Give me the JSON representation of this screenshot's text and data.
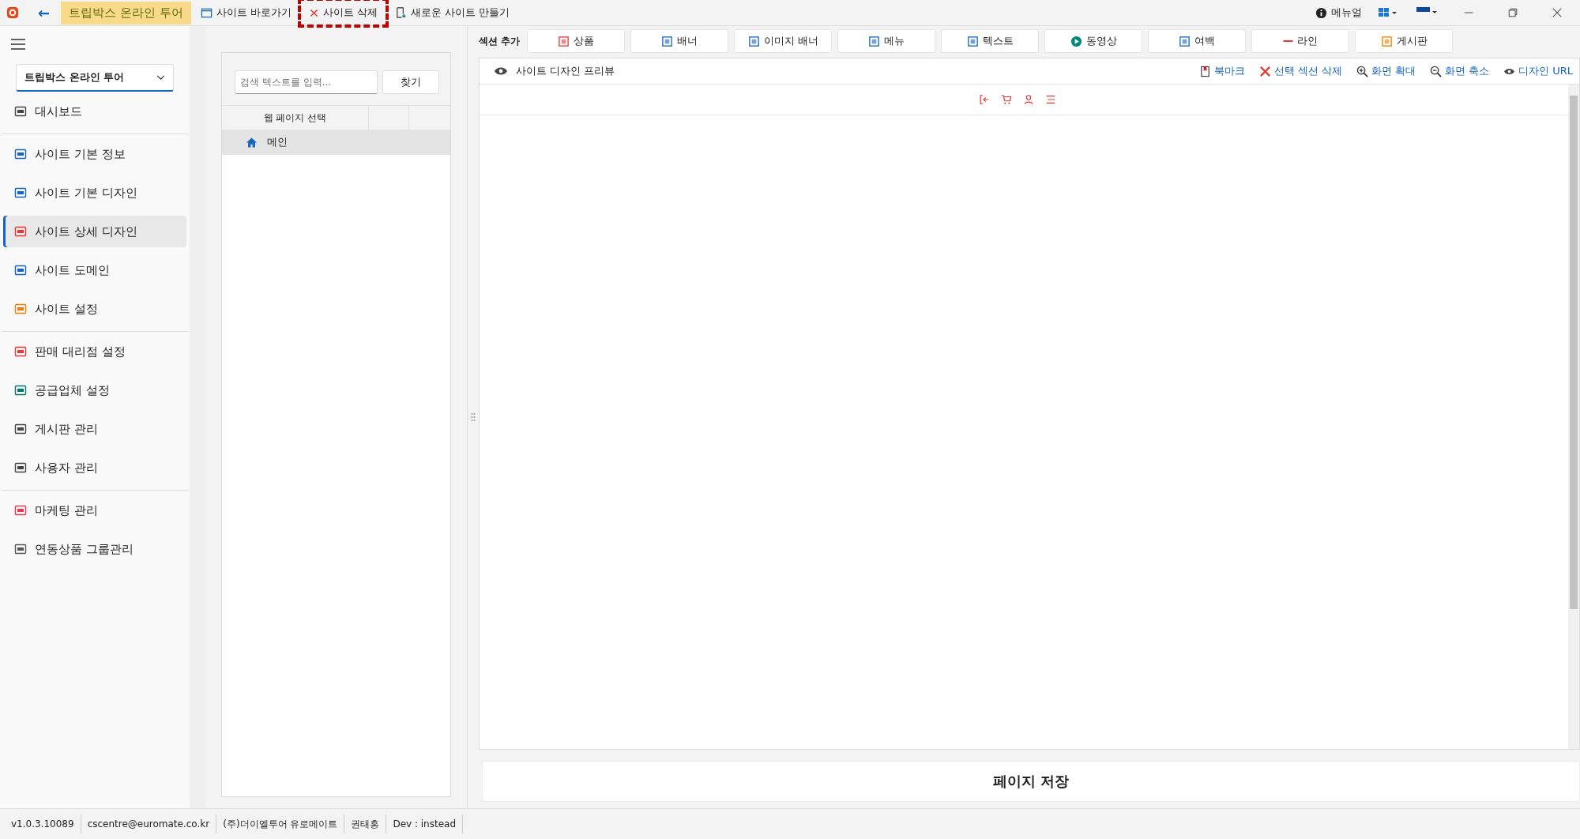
{
  "title_bar": {
    "back": "←",
    "site_name": "트립박스 온라인 투어",
    "actions": [
      {
        "label": "사이트 바로가기",
        "highlighted": false
      },
      {
        "label": "사이트 삭제",
        "highlighted": true
      },
      {
        "label": "새로운 사이트 만들기",
        "highlighted": false
      }
    ],
    "manual": "메뉴얼"
  },
  "sidebar": {
    "site_select": "트립박스 온라인 투어",
    "groups": [
      [
        {
          "label": "대시보드",
          "selected": false
        }
      ],
      [
        {
          "label": "사이트 기본 정보",
          "selected": false
        },
        {
          "label": "사이트 기본 디자인",
          "selected": false
        },
        {
          "label": "사이트 상세 디자인",
          "selected": true
        },
        {
          "label": "사이트 도메인",
          "selected": false
        },
        {
          "label": "사이트 설정",
          "selected": false
        }
      ],
      [
        {
          "label": "판매 대리점 설정",
          "selected": false
        },
        {
          "label": "공급업체 설정",
          "selected": false
        },
        {
          "label": "게시판 관리",
          "selected": false
        },
        {
          "label": "사용자 관리",
          "selected": false
        }
      ],
      [
        {
          "label": "마케팅 관리",
          "selected": false
        },
        {
          "label": "연동상품 그룹관리",
          "selected": false
        }
      ]
    ]
  },
  "page_list": {
    "search": {
      "placeholder": "검색 텍스트를 입력..."
    },
    "search_button": "찾기",
    "column": "웹 페이지 선택",
    "rows": [
      {
        "label": "메인",
        "selected": true
      }
    ]
  },
  "section_toolbar": {
    "label": "섹션 추가",
    "buttons": [
      "상품",
      "배너",
      "이미지 배너",
      "메뉴",
      "텍스트",
      "동영상",
      "여백",
      "라인",
      "게시판"
    ]
  },
  "preview_toolbar": {
    "title": "사이트 디자인 프리뷰",
    "actions": [
      "북마크",
      "선택 섹션 삭제",
      "화면 확대",
      "화면 축소",
      "디자인 URL"
    ]
  },
  "save_button": "페이지 저장",
  "status_bar": [
    "v1.0.3.10089",
    "cscentre@euromate.co.kr",
    "(주)더이엘투어 유로메이트",
    "권태흥",
    "Dev : instead"
  ]
}
